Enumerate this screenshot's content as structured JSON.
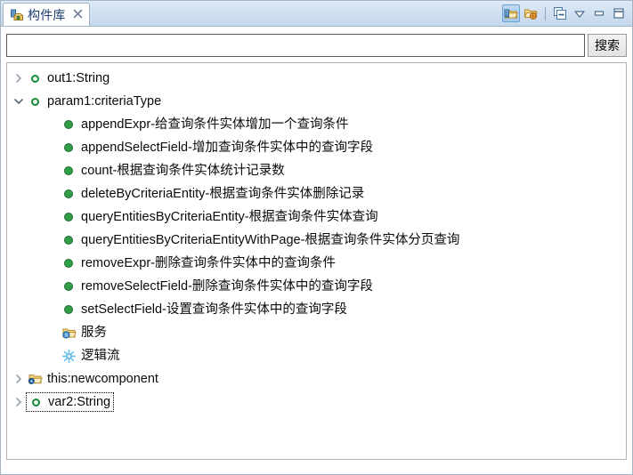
{
  "window": {
    "tab": {
      "label": "构件库",
      "icon": "component-library-icon",
      "close_icon": "close-icon"
    },
    "toolbar": [
      {
        "name": "show-components-button",
        "icon": "folder-chip-icon",
        "selected": true
      },
      {
        "name": "show-services-button",
        "icon": "folder-globe-icon",
        "selected": false
      },
      {
        "name": "collapse-all-button",
        "icon": "collapse-all-icon",
        "selected": false
      },
      {
        "name": "view-menu-button",
        "icon": "chevron-down-icon",
        "selected": false
      },
      {
        "name": "minimize-button",
        "icon": "minimize-icon",
        "selected": false
      },
      {
        "name": "maximize-button",
        "icon": "maximize-icon",
        "selected": false
      }
    ]
  },
  "search": {
    "value": "",
    "placeholder": "",
    "button_label": "搜索"
  },
  "tree": {
    "nodes": [
      {
        "label": "out1:String",
        "icon": "variable-icon",
        "arrow": "collapsed",
        "indent": 1,
        "focused": false
      },
      {
        "label": "param1:criteriaType",
        "icon": "variable-icon",
        "arrow": "expanded",
        "indent": 1,
        "focused": false
      },
      {
        "label": "appendExpr-给查询条件实体增加一个查询条件",
        "icon": "method-icon",
        "arrow": "none",
        "indent": 2,
        "focused": false
      },
      {
        "label": "appendSelectField-增加查询条件实体中的查询字段",
        "icon": "method-icon",
        "arrow": "none",
        "indent": 2,
        "focused": false
      },
      {
        "label": "count-根据查询条件实体统计记录数",
        "icon": "method-icon",
        "arrow": "none",
        "indent": 2,
        "focused": false
      },
      {
        "label": "deleteByCriteriaEntity-根据查询条件实体删除记录",
        "icon": "method-icon",
        "arrow": "none",
        "indent": 2,
        "focused": false
      },
      {
        "label": "queryEntitiesByCriteriaEntity-根据查询条件实体查询",
        "icon": "method-icon",
        "arrow": "none",
        "indent": 2,
        "focused": false
      },
      {
        "label": "queryEntitiesByCriteriaEntityWithPage-根据查询条件实体分页查询",
        "icon": "method-icon",
        "arrow": "none",
        "indent": 2,
        "focused": false
      },
      {
        "label": "removeExpr-删除查询条件实体中的查询条件",
        "icon": "method-icon",
        "arrow": "none",
        "indent": 2,
        "focused": false
      },
      {
        "label": "removeSelectField-删除查询条件实体中的查询字段",
        "icon": "method-icon",
        "arrow": "none",
        "indent": 2,
        "focused": false
      },
      {
        "label": "setSelectField-设置查询条件实体中的查询字段",
        "icon": "method-icon",
        "arrow": "none",
        "indent": 2,
        "focused": false
      },
      {
        "label": "服务",
        "icon": "service-folder-icon",
        "arrow": "none",
        "indent": 2,
        "focused": false
      },
      {
        "label": "逻辑流",
        "icon": "logic-flow-icon",
        "arrow": "none",
        "indent": 2,
        "focused": false
      },
      {
        "label": "this:newcomponent",
        "icon": "component-folder-icon",
        "arrow": "collapsed",
        "indent": 1,
        "focused": false
      },
      {
        "label": "var2:String",
        "icon": "variable-icon",
        "arrow": "collapsed",
        "indent": 1,
        "focused": true
      }
    ]
  },
  "colors": {
    "tab_text": "#1c3f74",
    "variable_green": "#1c8a3c",
    "method_green": "#2f9e46",
    "folder_yellow": "#f2c14e",
    "logic_blue": "#7ec8e8",
    "tabbar_bg": "#cfdff0"
  }
}
